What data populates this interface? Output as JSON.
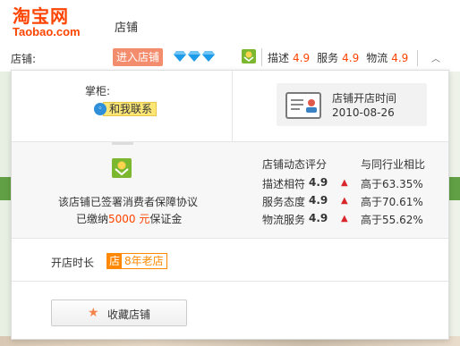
{
  "header": {
    "logo_cn": "淘宝网",
    "logo_en": "Taobao.com",
    "title": "店铺"
  },
  "shopbar": {
    "label": "店铺:",
    "enter_button": "进入店铺",
    "ratings": [
      {
        "label": "描述",
        "value": "4.9"
      },
      {
        "label": "服务",
        "value": "4.9"
      },
      {
        "label": "物流",
        "value": "4.9"
      }
    ]
  },
  "popup": {
    "keeper_label": "掌柜:",
    "contact_label": "和我联系",
    "open_date_label": "店铺开店时间",
    "open_date_value": "2010-08-26",
    "guarantee_line1": "该店铺已签署消费者保障协议",
    "guarantee_line2_prefix": "已缴纳",
    "guarantee_amount": "5000 元",
    "guarantee_line2_suffix": "保证金",
    "dsr_header": "店铺动态评分",
    "compare_header": "与同行业相比",
    "dsr": [
      {
        "name": "描述相符",
        "score": "4.9",
        "compare": "高于63.35%"
      },
      {
        "name": "服务态度",
        "score": "4.9",
        "compare": "高于70.61%"
      },
      {
        "name": "物流服务",
        "score": "4.9",
        "compare": "高于55.62%"
      }
    ],
    "shop_age_label": "开店时长",
    "shop_age_badge_icon": "店",
    "shop_age_badge_text": "8年老店",
    "favorite_button": "收藏店铺"
  },
  "colors": {
    "brand": "#ff4400",
    "enter_button_bg": "#f48d6d",
    "diamond": "#1e9be8",
    "badge": "#ff8800"
  }
}
